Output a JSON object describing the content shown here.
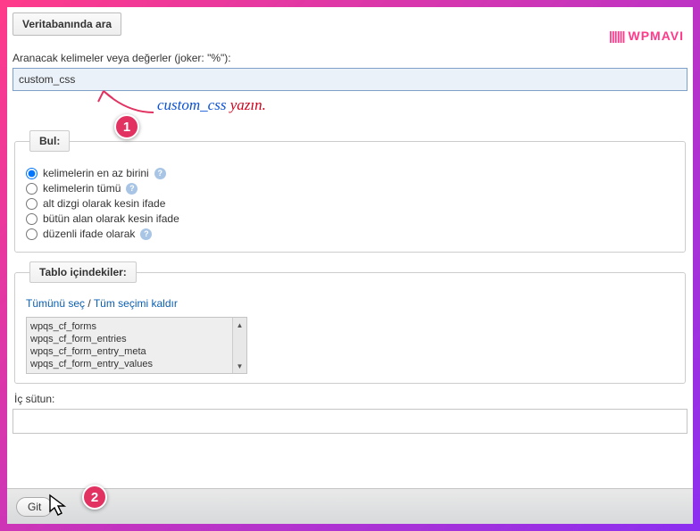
{
  "tab_title": "Veritabanında ara",
  "watermark": "WPMAVI",
  "search_label": "Aranacak kelimeler veya değerler (joker: \"%\"):",
  "search_value": "custom_css",
  "annotation": {
    "blue": "custom_css",
    "red": " yazın."
  },
  "badges": {
    "one": "1",
    "two": "2"
  },
  "find": {
    "legend": "Bul:",
    "options": [
      {
        "label": "kelimelerin en az birini",
        "checked": true,
        "help": true
      },
      {
        "label": "kelimelerin tümü",
        "checked": false,
        "help": true
      },
      {
        "label": "alt dizgi olarak kesin ifade",
        "checked": false,
        "help": false
      },
      {
        "label": "bütün alan olarak kesin ifade",
        "checked": false,
        "help": false
      },
      {
        "label": "düzenli ifade olarak",
        "checked": false,
        "help": true
      }
    ]
  },
  "tables": {
    "legend": "Tablo içindekiler:",
    "select_all": "Tümünü seç",
    "unselect_all": "Tüm seçimi kaldır",
    "items": [
      "wpqs_cf_forms",
      "wpqs_cf_form_entries",
      "wpqs_cf_form_entry_meta",
      "wpqs_cf_form_entry_values"
    ]
  },
  "inside_column_label": "İç sütun:",
  "inside_column_value": "",
  "go_button": "Git"
}
